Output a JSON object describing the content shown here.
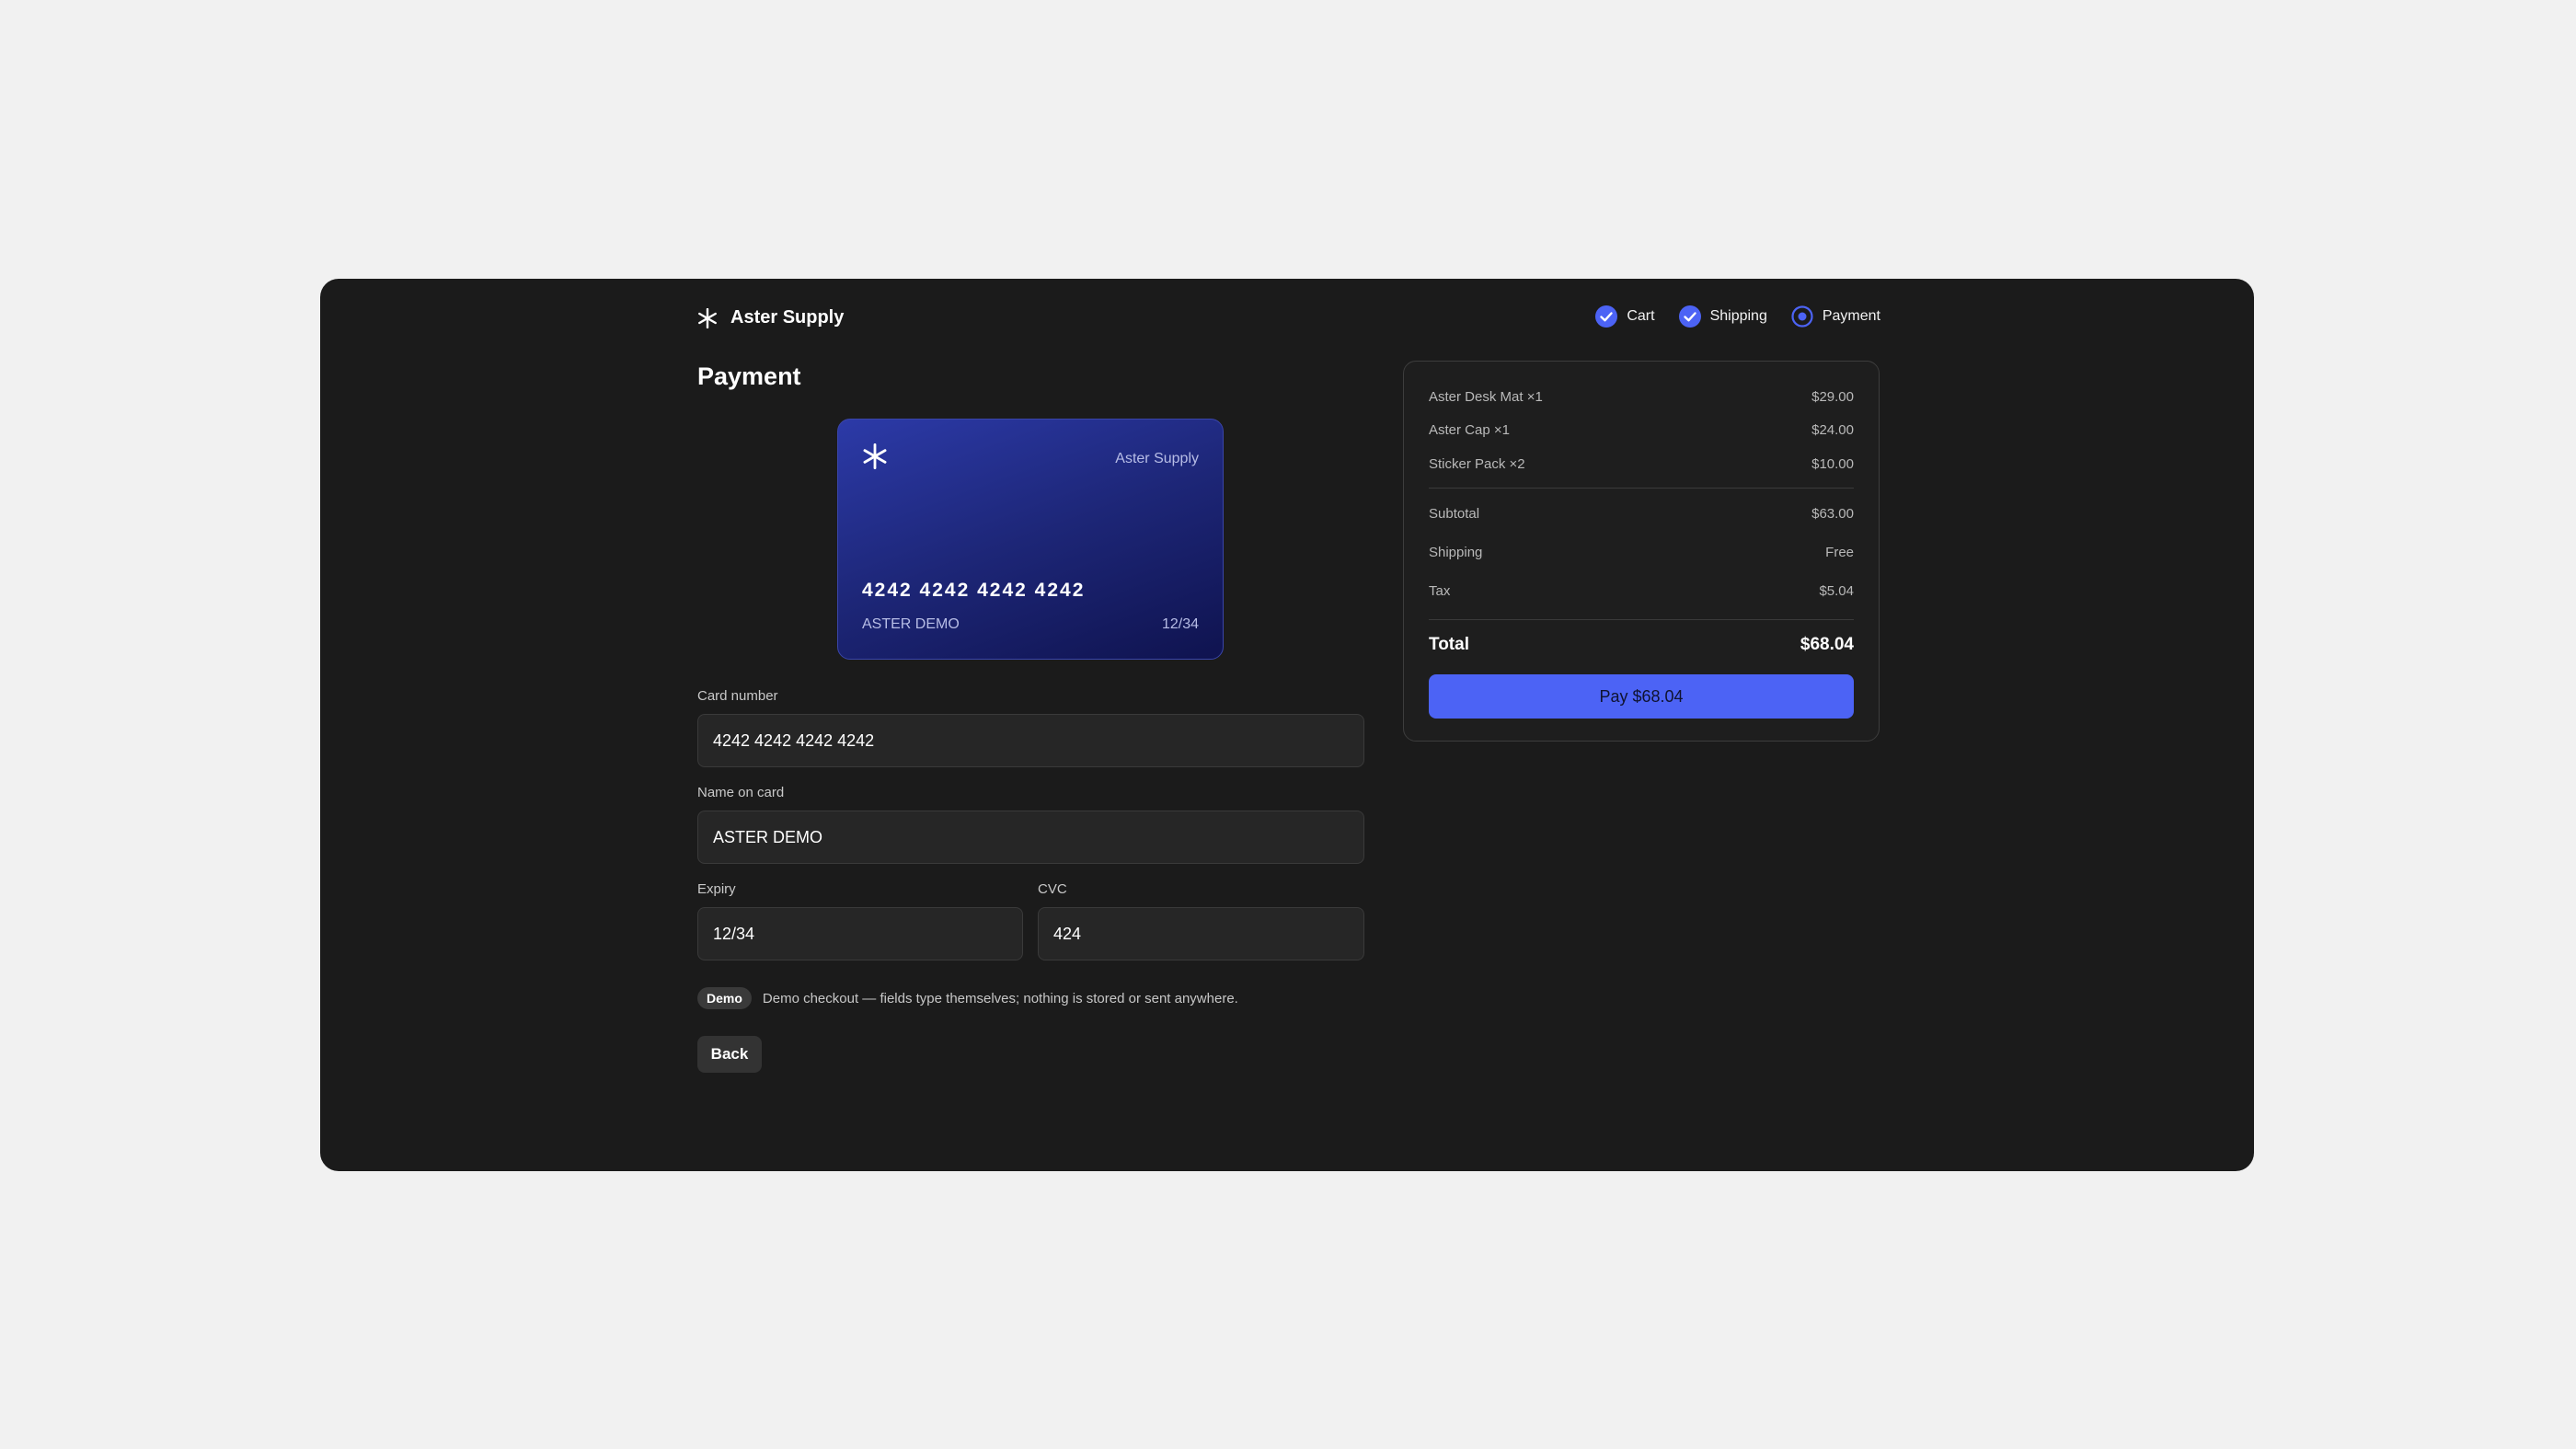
{
  "brand": {
    "name": "Aster Supply"
  },
  "steps": [
    {
      "label": "Cart",
      "state": "done"
    },
    {
      "label": "Shipping",
      "state": "done"
    },
    {
      "label": "Payment",
      "state": "current"
    }
  ],
  "page_title": "Payment",
  "card_preview": {
    "brand": "Aster Supply",
    "number": "4242 4242 4242 4242",
    "name": "ASTER DEMO",
    "expiry": "12/34"
  },
  "form": {
    "card_number": {
      "label": "Card number",
      "value": "4242 4242 4242 4242"
    },
    "name_on_card": {
      "label": "Name on card",
      "value": "ASTER DEMO"
    },
    "expiry": {
      "label": "Expiry",
      "value": "12/34"
    },
    "cvc": {
      "label": "CVC",
      "value": "424"
    }
  },
  "demo": {
    "badge": "Demo",
    "note": "Demo checkout — fields type themselves; nothing is stored or sent anywhere."
  },
  "back_label": "Back",
  "summary": {
    "items": [
      {
        "name": "Aster Desk Mat ×1",
        "price": "$29.00"
      },
      {
        "name": "Aster Cap ×1",
        "price": "$24.00"
      },
      {
        "name": "Sticker Pack ×2",
        "price": "$10.00"
      }
    ],
    "subtotal": {
      "label": "Subtotal",
      "value": "$63.00"
    },
    "shipping": {
      "label": "Shipping",
      "value": "Free"
    },
    "tax": {
      "label": "Tax",
      "value": "$5.04"
    },
    "total": {
      "label": "Total",
      "value": "$68.04"
    },
    "pay_label": "Pay $68.04"
  },
  "colors": {
    "accent": "#4c63f5",
    "frame_bg": "#1b1b1b",
    "page_bg": "#f1f1f1",
    "card_gradient_start": "#2c3aa8",
    "card_gradient_end": "#0f134f"
  },
  "icons": {
    "brand": "asterisk-icon",
    "step_done": "check-circle-icon",
    "step_current": "radio-circle-icon"
  }
}
